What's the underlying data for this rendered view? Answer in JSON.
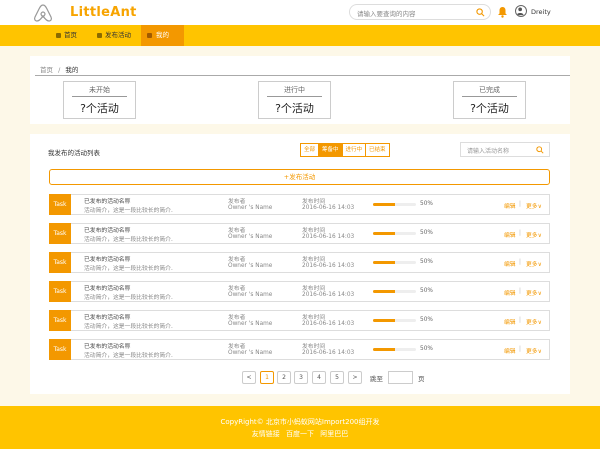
{
  "header": {
    "logo_text": "LittleAnt",
    "search_placeholder": "请输入要查询的内容",
    "username": "Dreity"
  },
  "nav": {
    "items": [
      {
        "label": "首页"
      },
      {
        "label": "发布活动"
      },
      {
        "label": "我的"
      }
    ],
    "active_index": 2
  },
  "breadcrumb": {
    "home": "首页",
    "separator": "/",
    "current": "我的"
  },
  "stats": [
    {
      "label": "未开始",
      "value": "?个活动"
    },
    {
      "label": "进行中",
      "value": "?个活动"
    },
    {
      "label": "已完成",
      "value": "?个活动"
    }
  ],
  "list": {
    "title": "我发布的活动列表",
    "filters": [
      "全部",
      "筹备中",
      "进行中",
      "已结束"
    ],
    "active_filter": 1,
    "search_placeholder": "请输入活动名称",
    "publish_label": "+发布活动",
    "rows": [
      {
        "tag": "Task",
        "name": "已发布的活动名称",
        "desc": "活动简介，这是一段比较长的简介.",
        "owner_label": "发布者",
        "owner": "Owner  's Name",
        "time_label": "发布时间",
        "time": "2016-06-16 14:03",
        "progress": 0.5,
        "progress_text": "50%",
        "edit": "编辑",
        "sep": "|",
        "more": "更多∨"
      },
      {
        "tag": "Task",
        "name": "已发布的活动名称",
        "desc": "活动简介，这是一段比较长的简介.",
        "owner_label": "发布者",
        "owner": "Owner  's Name",
        "time_label": "发布时间",
        "time": "2016-06-16 14:03",
        "progress": 0.5,
        "progress_text": "50%",
        "edit": "编辑",
        "sep": "|",
        "more": "更多∨"
      },
      {
        "tag": "Task",
        "name": "已发布的活动名称",
        "desc": "活动简介，这是一段比较长的简介.",
        "owner_label": "发布者",
        "owner": "Owner  's Name",
        "time_label": "发布时间",
        "time": "2016-06-16 14:03",
        "progress": 0.5,
        "progress_text": "50%",
        "edit": "编辑",
        "sep": "|",
        "more": "更多∨"
      },
      {
        "tag": "Task",
        "name": "已发布的活动名称",
        "desc": "活动简介，这是一段比较长的简介.",
        "owner_label": "发布者",
        "owner": "Owner  's Name",
        "time_label": "发布时间",
        "time": "2016-06-16 14:03",
        "progress": 0.5,
        "progress_text": "50%",
        "edit": "编辑",
        "sep": "|",
        "more": "更多∨"
      },
      {
        "tag": "Task",
        "name": "已发布的活动名称",
        "desc": "活动简介，这是一段比较长的简介.",
        "owner_label": "发布者",
        "owner": "Owner  's Name",
        "time_label": "发布时间",
        "time": "2016-06-16 14:03",
        "progress": 0.5,
        "progress_text": "50%",
        "edit": "编辑",
        "sep": "|",
        "more": "更多∨"
      },
      {
        "tag": "Task",
        "name": "已发布的活动名称",
        "desc": "活动简介，这是一段比较长的简介.",
        "owner_label": "发布者",
        "owner": "Owner  's Name",
        "time_label": "发布时间",
        "time": "2016-06-16 14:03",
        "progress": 0.5,
        "progress_text": "50%",
        "edit": "编辑",
        "sep": "|",
        "more": "更多∨"
      }
    ]
  },
  "pagination": {
    "prev": "<",
    "next": ">",
    "pages": [
      "1",
      "2",
      "3",
      "4",
      "5"
    ],
    "current_page": "1",
    "jump_label": "跳至",
    "page_unit": "页"
  },
  "footer": {
    "line1": "CopyRight© 北京市小蚂蚁网站Import200组开发",
    "links": [
      "友情链接",
      "百度一下",
      "阿里巴巴"
    ]
  },
  "colors": {
    "accent": "#f39800",
    "header_yellow": "#ffc400",
    "bg": "#fdf8e8"
  },
  "icons": [
    "airbnb-logo-icon",
    "search-icon",
    "bell-icon",
    "avatar-icon",
    "nav-dot-icon"
  ]
}
